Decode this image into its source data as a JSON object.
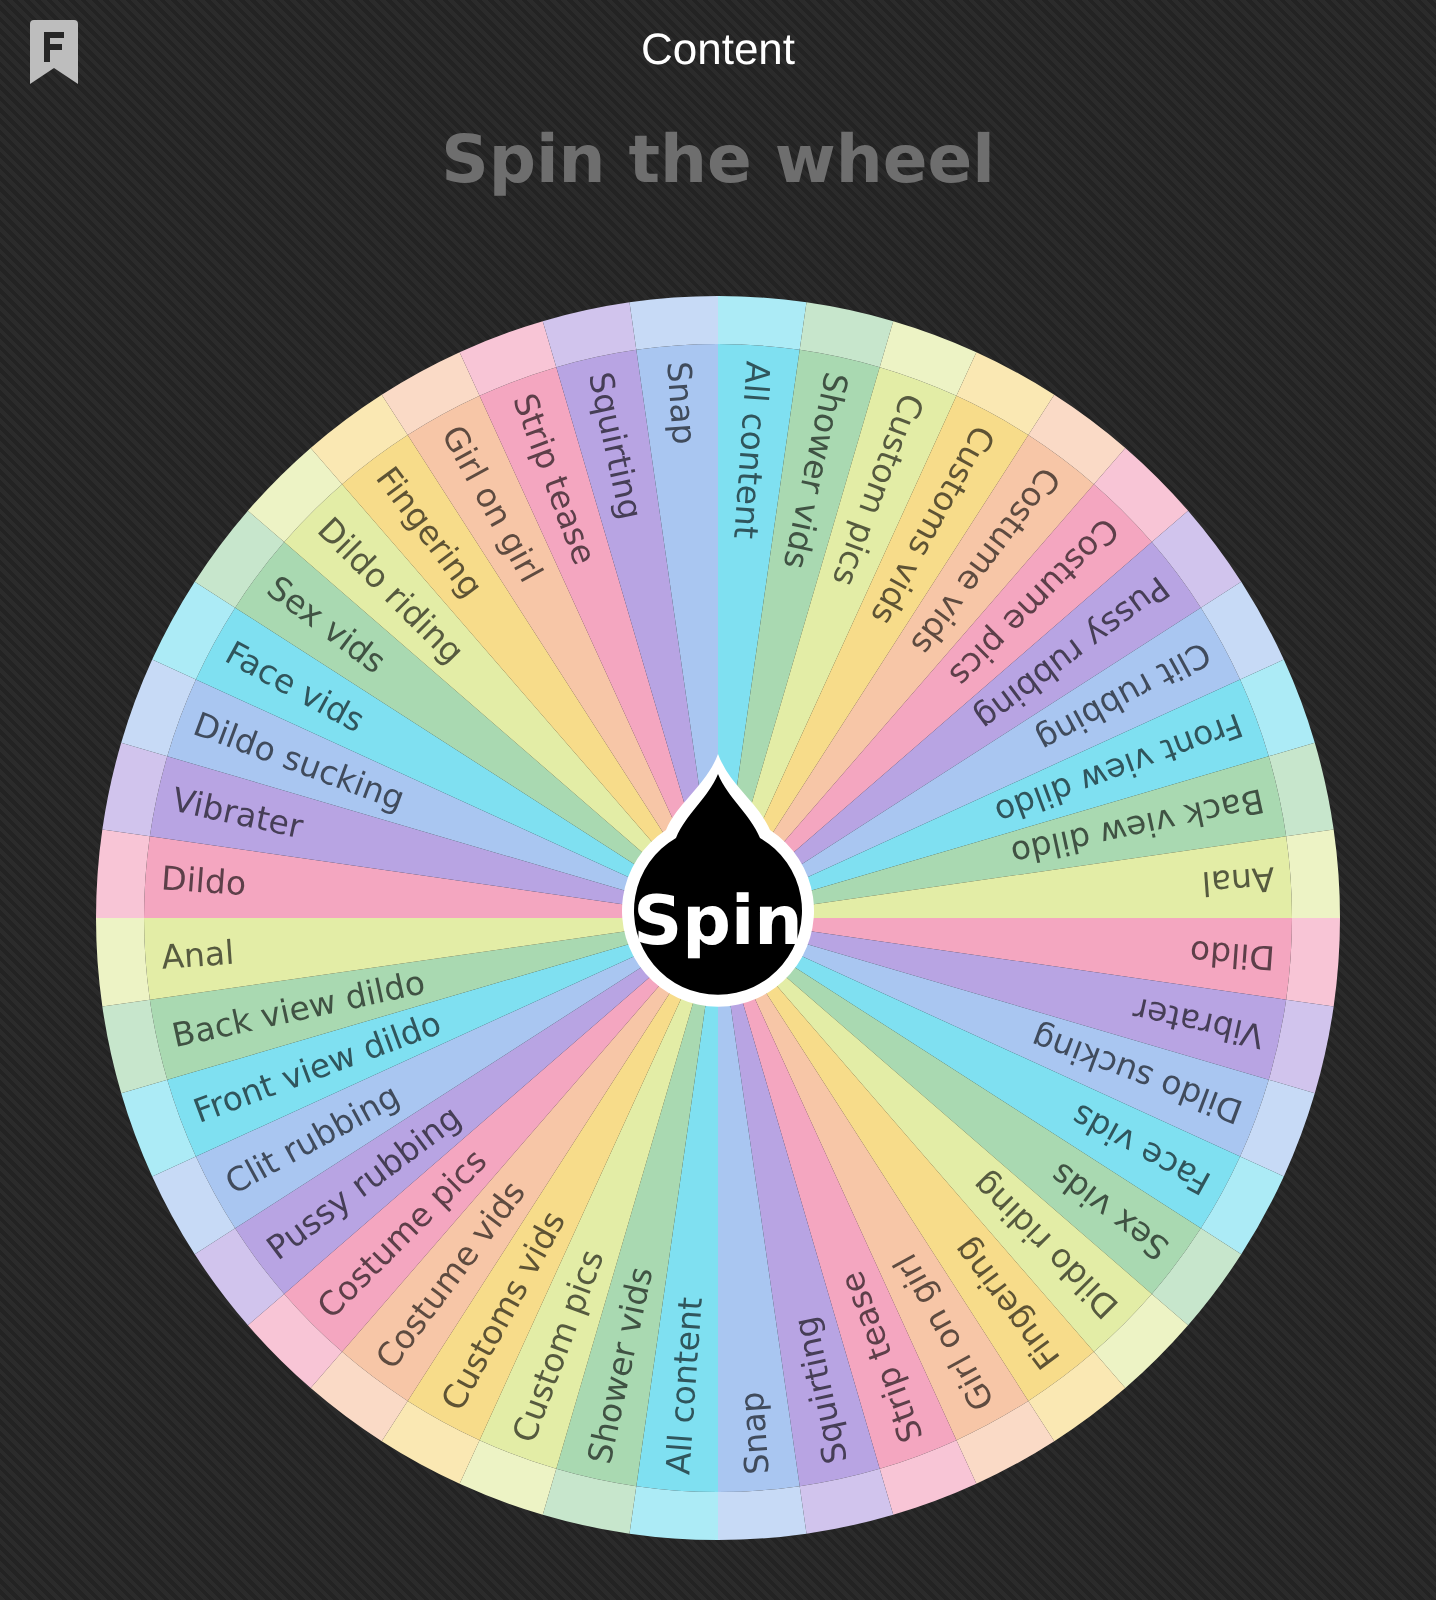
{
  "header": {
    "title": "Content"
  },
  "heading": "Spin the wheel",
  "wheel": {
    "button": "Spin",
    "segments": [
      {
        "label": "All content",
        "color": "#acebf6"
      },
      {
        "label": "Shower vids",
        "color": "#c7e6cc"
      },
      {
        "label": "Custom pics",
        "color": "#edf3c5"
      },
      {
        "label": "Customs vids",
        "color": "#fae8b3"
      },
      {
        "label": "Costume vids",
        "color": "#fadac6"
      },
      {
        "label": "Costume pics",
        "color": "#f8c5d6"
      },
      {
        "label": "Pussy rubbing",
        "color": "#d1c4ed"
      },
      {
        "label": "Clit rubbing",
        "color": "#c7daf6"
      },
      {
        "label": "Front view dildo",
        "color": "#acebf6"
      },
      {
        "label": "Back view dildo",
        "color": "#c7e6cc"
      },
      {
        "label": "Anal",
        "color": "#edf3c5"
      },
      {
        "label": "Dildo",
        "color": "#f8c5d6"
      },
      {
        "label": "Vibrater",
        "color": "#d1c4ed"
      },
      {
        "label": "Dildo sucking",
        "color": "#c7daf6"
      },
      {
        "label": "Face vids",
        "color": "#acebf6"
      },
      {
        "label": "Sex vids",
        "color": "#c7e6cc"
      },
      {
        "label": "Dildo riding",
        "color": "#edf3c5"
      },
      {
        "label": "Fingering",
        "color": "#fae8b3"
      },
      {
        "label": "Girl on girl",
        "color": "#fadac6"
      },
      {
        "label": "Strip tease",
        "color": "#f8c5d6"
      },
      {
        "label": "Squirting",
        "color": "#d1c4ed"
      },
      {
        "label": "Snap",
        "color": "#c7daf6"
      },
      {
        "label": "All content",
        "color": "#acebf6"
      },
      {
        "label": "Shower vids",
        "color": "#c7e6cc"
      },
      {
        "label": "Custom pics",
        "color": "#edf3c5"
      },
      {
        "label": "Customs vids",
        "color": "#fae8b3"
      },
      {
        "label": "Costume vids",
        "color": "#fadac6"
      },
      {
        "label": "Costume pics",
        "color": "#f8c5d6"
      },
      {
        "label": "Pussy rubbing",
        "color": "#d1c4ed"
      },
      {
        "label": "Clit rubbing",
        "color": "#c7daf6"
      },
      {
        "label": "Front view dildo",
        "color": "#acebf6"
      },
      {
        "label": "Back view dildo",
        "color": "#c7e6cc"
      },
      {
        "label": "Anal",
        "color": "#edf3c5"
      },
      {
        "label": "Dildo",
        "color": "#f8c5d6"
      },
      {
        "label": "Vibrater",
        "color": "#d1c4ed"
      },
      {
        "label": "Dildo sucking",
        "color": "#c7daf6"
      },
      {
        "label": "Face vids",
        "color": "#acebf6"
      },
      {
        "label": "Sex vids",
        "color": "#c7e6cc"
      },
      {
        "label": "Dildo riding",
        "color": "#edf3c5"
      },
      {
        "label": "Fingering",
        "color": "#fae8b3"
      },
      {
        "label": "Girl on girl",
        "color": "#fadac6"
      },
      {
        "label": "Strip tease",
        "color": "#f8c5d6"
      },
      {
        "label": "Squirting",
        "color": "#d1c4ed"
      },
      {
        "label": "Snap",
        "color": "#c7daf6"
      }
    ]
  }
}
